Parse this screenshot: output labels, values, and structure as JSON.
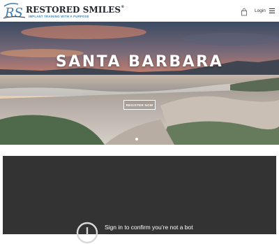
{
  "header": {
    "brand": "RESTORED SMILES",
    "brand_mark": "®",
    "tagline": "IMPLANT TRAINING WITH A PURPOSE",
    "login_label": "Login",
    "icons": [
      "logo-rs-mark",
      "cart-icon",
      "hamburger-menu-icon"
    ]
  },
  "hero": {
    "title": "SANTA BARBARA",
    "register_label": "REGISTER NOW",
    "slide_count": 1,
    "active_slide": 1
  },
  "captcha": {
    "message": "Sign in to confirm you’re not a bot",
    "icon": "alert-circle-icon"
  },
  "colors": {
    "brand_dark": "#1f2430",
    "brand_blue": "#3c7db4",
    "panel": "#333333"
  }
}
